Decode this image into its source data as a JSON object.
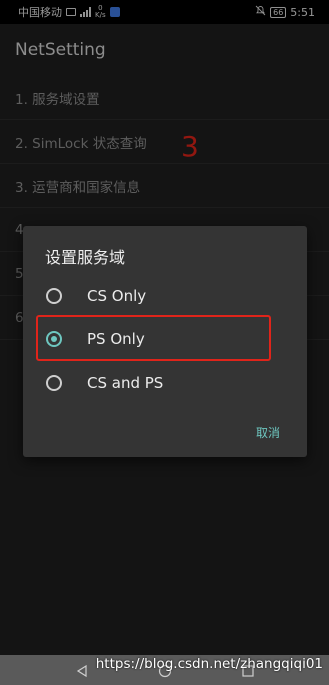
{
  "status_bar": {
    "carrier": "中国移动",
    "net_speed": "0\nK/s",
    "battery": "66",
    "time": "5:51"
  },
  "app_bar": {
    "title": "NetSetting"
  },
  "menu": {
    "items": [
      {
        "label": "1. 服务域设置"
      },
      {
        "label": "2. SimLock 状态查询"
      },
      {
        "label": "3. 运营商和国家信息"
      },
      {
        "label": "4."
      },
      {
        "label": "5."
      },
      {
        "label": "6."
      }
    ]
  },
  "annotation": {
    "step_number": "3",
    "color": "#e0241a"
  },
  "dialog": {
    "title": "设置服务域",
    "options": [
      {
        "label": "CS Only",
        "checked": false
      },
      {
        "label": "PS Only",
        "checked": true
      },
      {
        "label": "CS and PS",
        "checked": false
      }
    ],
    "cancel_label": "取消",
    "accent_color": "#6ec7c0"
  },
  "nav_bar": {
    "icons": [
      "back-icon",
      "home-icon",
      "recents-icon"
    ]
  },
  "watermark": "https://blog.csdn.net/zhangqiqi01"
}
